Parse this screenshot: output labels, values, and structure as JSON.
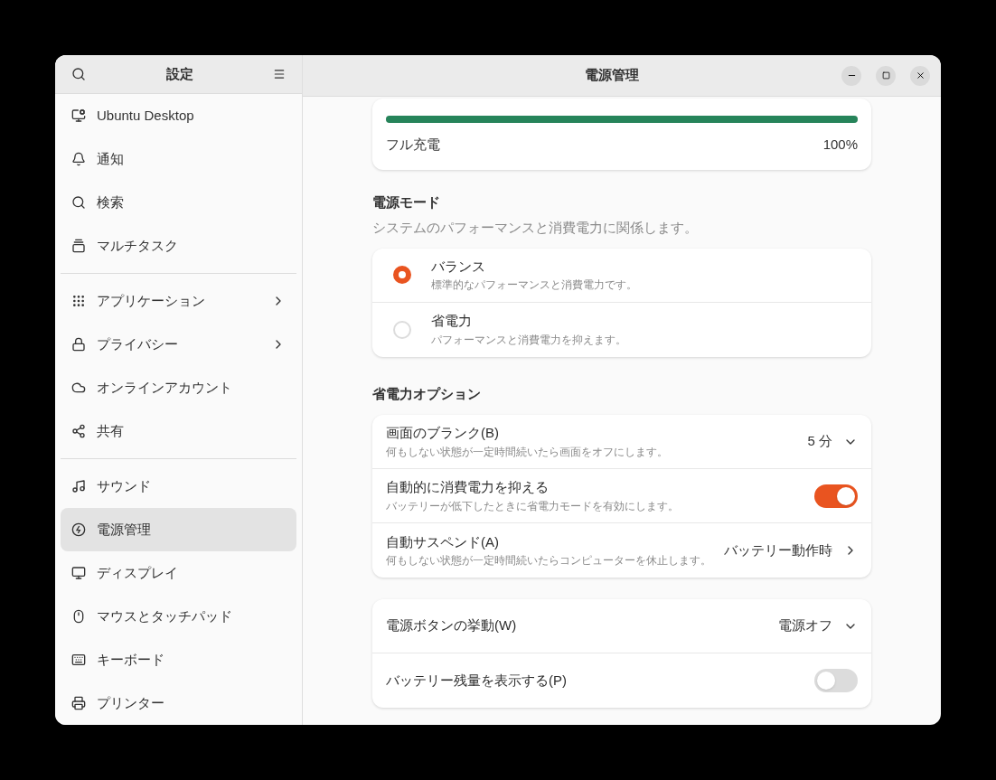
{
  "sidebar": {
    "title": "設定",
    "sections": [
      [
        {
          "label": "Ubuntu Desktop",
          "submenu": false,
          "selected": false
        },
        {
          "label": "通知",
          "submenu": false,
          "selected": false
        },
        {
          "label": "検索",
          "submenu": false,
          "selected": false
        },
        {
          "label": "マルチタスク",
          "submenu": false,
          "selected": false
        }
      ],
      [
        {
          "label": "アプリケーション",
          "submenu": true,
          "selected": false
        },
        {
          "label": "プライバシー",
          "submenu": true,
          "selected": false
        },
        {
          "label": "オンラインアカウント",
          "submenu": false,
          "selected": false
        },
        {
          "label": "共有",
          "submenu": false,
          "selected": false
        }
      ],
      [
        {
          "label": "サウンド",
          "submenu": false,
          "selected": false
        },
        {
          "label": "電源管理",
          "submenu": false,
          "selected": true
        },
        {
          "label": "ディスプレイ",
          "submenu": false,
          "selected": false
        },
        {
          "label": "マウスとタッチパッド",
          "submenu": false,
          "selected": false
        },
        {
          "label": "キーボード",
          "submenu": false,
          "selected": false
        },
        {
          "label": "プリンター",
          "submenu": false,
          "selected": false
        }
      ]
    ]
  },
  "title": "電源管理",
  "battery": {
    "level": 1,
    "label": "フル充電",
    "reading": "100%"
  },
  "power_mode": {
    "heading": "電源モード",
    "description": "システムのパフォーマンスと消費電力に関係します。",
    "options": [
      {
        "title": "バランス",
        "subtitle": "標準的なパフォーマンスと消費電力です。",
        "selected": true
      },
      {
        "title": "省電力",
        "subtitle": "パフォーマンスと消費電力を抑えます。",
        "selected": false
      }
    ]
  },
  "saving": {
    "heading": "省電力オプション",
    "rows": [
      {
        "kind": "dropdown",
        "title": "画面のブランク(B)",
        "subtitle": "何もしない状態が一定時間続いたら画面をオフにします。",
        "value": "5 分"
      },
      {
        "kind": "switch",
        "title": "自動的に消費電力を抑える",
        "subtitle": "バッテリーが低下したときに省電力モードを有効にします。",
        "on": true
      },
      {
        "kind": "link",
        "title": "自動サスペンド(A)",
        "subtitle": "何もしない状態が一定時間続いたらコンピューターを休止します。",
        "value": "バッテリー動作時"
      }
    ]
  },
  "general": {
    "rows": [
      {
        "kind": "dropdown",
        "title": "電源ボタンの挙動(W)",
        "value": "電源オフ"
      },
      {
        "kind": "switch",
        "title": "バッテリー残量を表示する(P)",
        "on": false
      }
    ]
  }
}
